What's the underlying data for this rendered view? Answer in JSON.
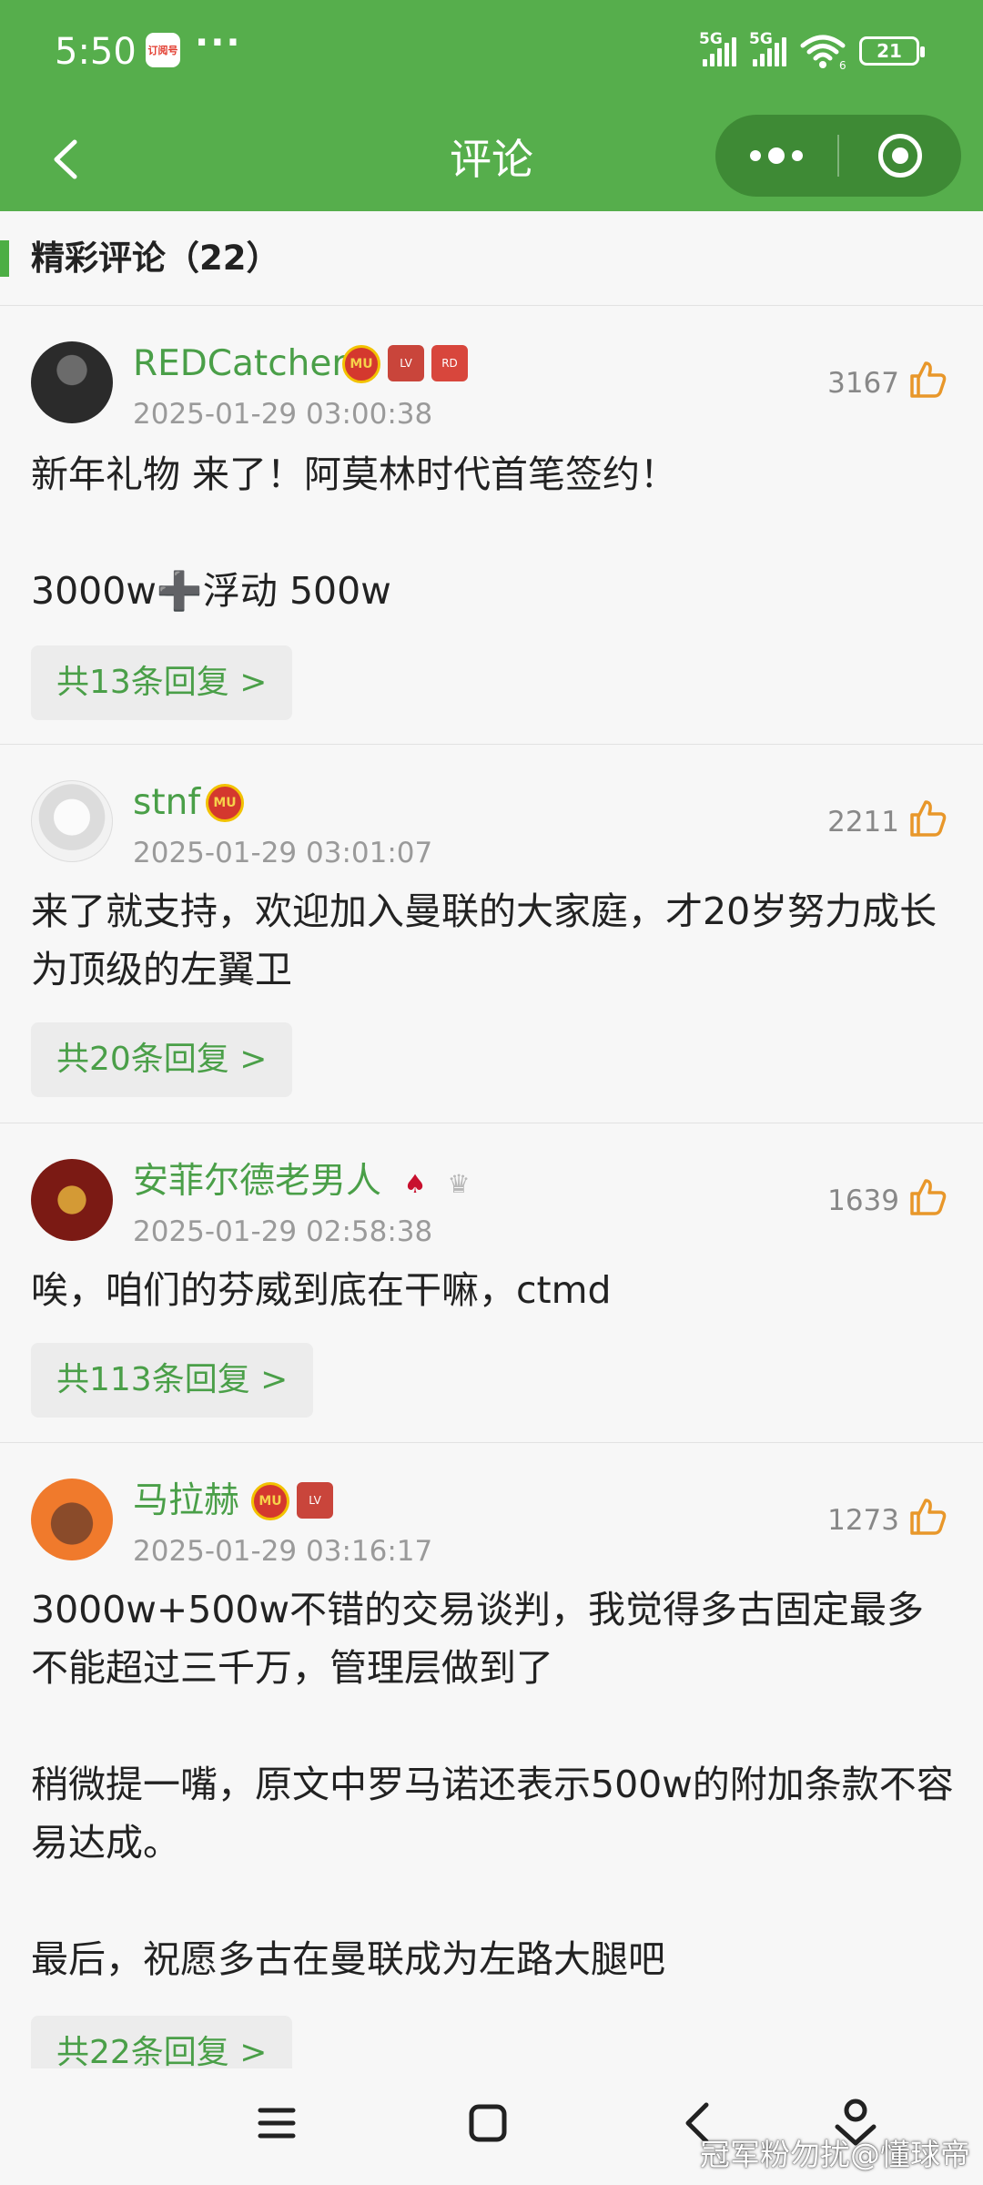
{
  "status_bar": {
    "time": "5:50",
    "app_badge": "订阅号",
    "more": "···",
    "signal_1": "5G",
    "signal_2": "5G",
    "wifi_sub": "6",
    "battery": "21"
  },
  "nav": {
    "title": "评论"
  },
  "section": {
    "title": "精彩评论（22）"
  },
  "comments": [
    {
      "username": "REDCatcher",
      "date": "2025-01-29 03:00:38",
      "likes": "3167",
      "text": "新年礼物 来了！阿莫林时代首笔签约！\n\n3000w➕浮动 500w",
      "reply_label": "共13条回复 >"
    },
    {
      "username": "stnf",
      "date": "2025-01-29 03:01:07",
      "likes": "2211",
      "text": "来了就支持，欢迎加入曼联的大家庭，才20岁努力成长为顶级的左翼卫",
      "reply_label": "共20条回复 >"
    },
    {
      "username": "安菲尔德老男人",
      "date": "2025-01-29 02:58:38",
      "likes": "1639",
      "text": "唉，咱们的芬威到底在干嘛，ctmd",
      "reply_label": "共113条回复 >"
    },
    {
      "username": "马拉赫",
      "date": "2025-01-29 03:16:17",
      "likes": "1273",
      "text": "3000w+500w不错的交易谈判，我觉得多古固定最多不能超过三千万，管理层做到了\n\n稍微提一嘴，原文中罗马诺还表示500w的附加条款不容易达成。\n\n最后，祝愿多古在曼联成为左路大腿吧",
      "reply_label": "共22条回复 >"
    }
  ],
  "watermark": "冠军粉勿扰@懂球帝",
  "colors": {
    "header_green": "#56ae4c",
    "username_green": "#4a9f48",
    "like_orange": "#e8972a"
  }
}
